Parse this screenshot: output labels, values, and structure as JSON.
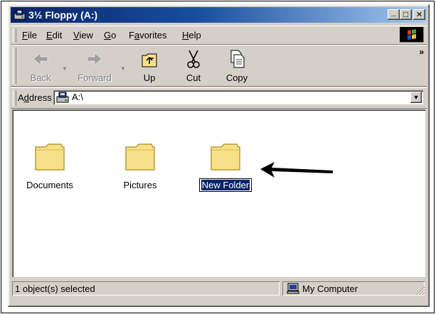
{
  "window": {
    "title": "3½ Floppy (A:)",
    "controls": {
      "minimize": "_",
      "maximize": "□",
      "close": "✕"
    }
  },
  "menubar": {
    "items": [
      {
        "label_u": "F",
        "label_rest": "ile"
      },
      {
        "label_u": "E",
        "label_rest": "dit"
      },
      {
        "label_u": "V",
        "label_rest": "iew"
      },
      {
        "label_u": "G",
        "label_rest": "o"
      },
      {
        "label_pre": "F",
        "label_u": "a",
        "label_rest": "vorites"
      },
      {
        "label_u": "H",
        "label_rest": "elp"
      }
    ]
  },
  "toolbar": {
    "back_label": "Back",
    "forward_label": "Forward",
    "up_label": "Up",
    "cut_label": "Cut",
    "copy_label": "Copy",
    "more": "»"
  },
  "addressbar": {
    "label_pre": "A",
    "label_u": "d",
    "label_rest": "dress",
    "value": "A:\\"
  },
  "folders": [
    {
      "name": "Documents"
    },
    {
      "name": "Pictures"
    },
    {
      "name": "New Folder",
      "renaming": true
    }
  ],
  "statusbar": {
    "selection": "1 object(s) selected",
    "zone": "My Computer"
  },
  "colors": {
    "titlebar_start": "#0a246a",
    "titlebar_end": "#a6caf0",
    "chrome": "#d4d0c8",
    "folder_fill": "#f6e08a",
    "selection": "#0a246a"
  }
}
